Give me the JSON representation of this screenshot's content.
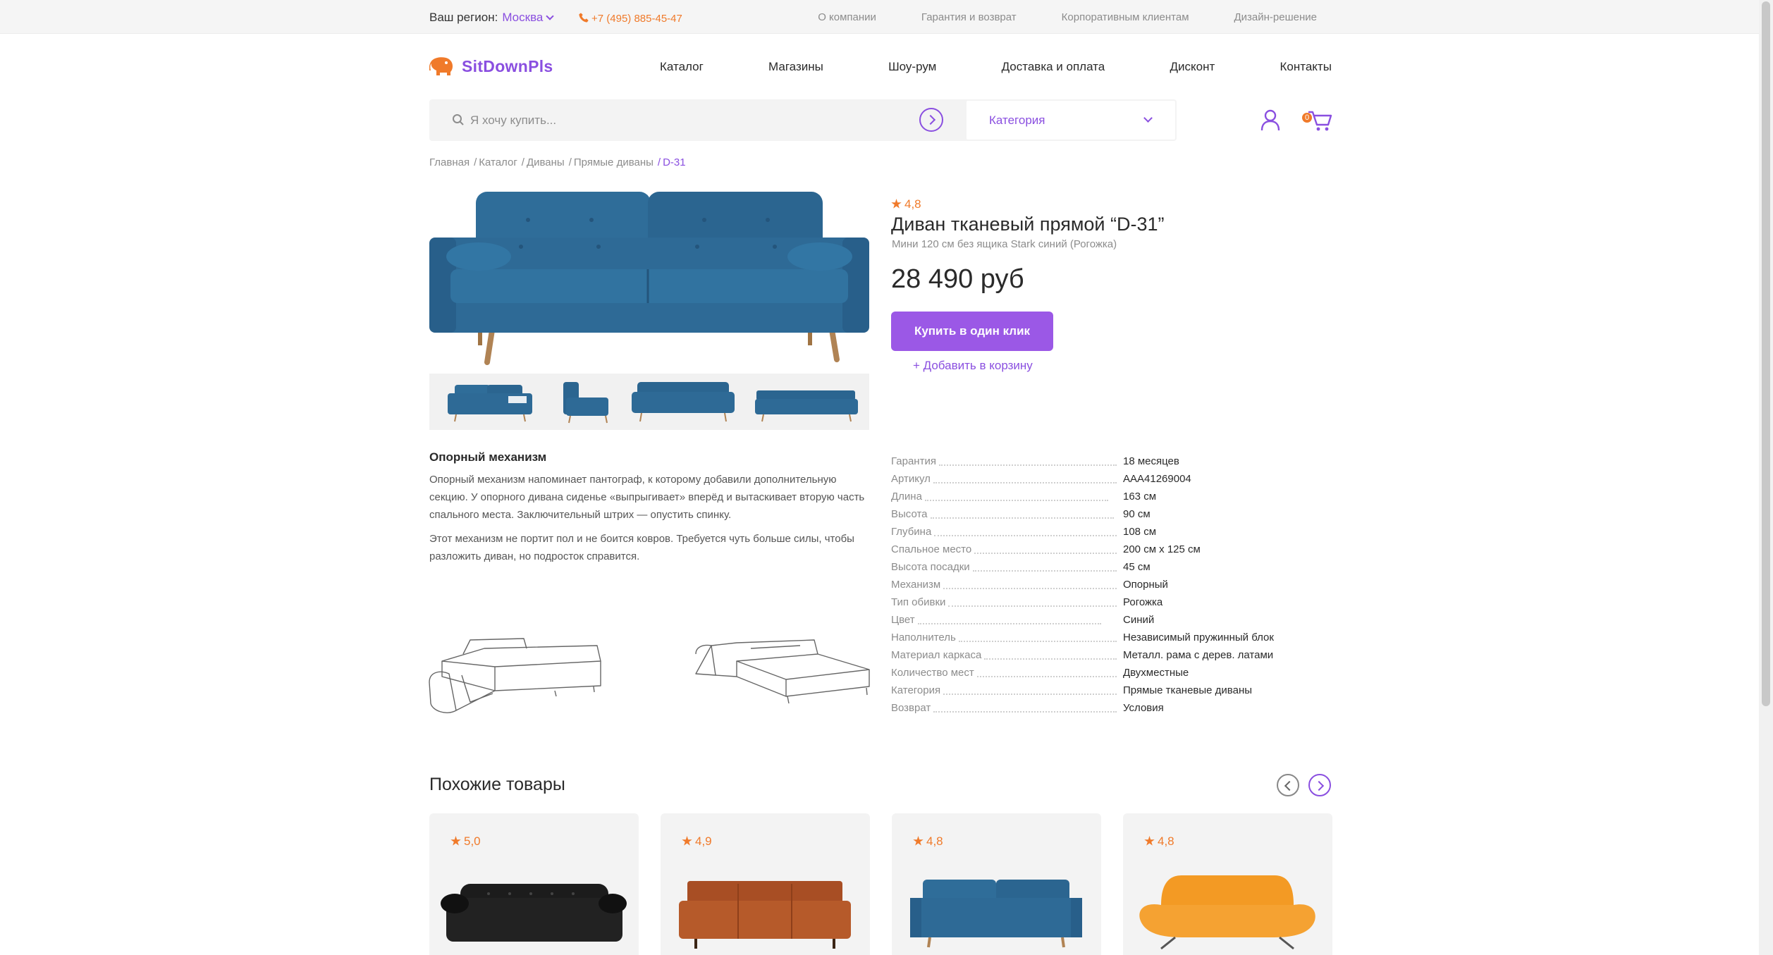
{
  "topbar": {
    "region_label": "Ваш регион:",
    "city": "Москва",
    "phone": "+7 (495) 885-45-47",
    "links": [
      "О компании",
      "Гарантия и возврат",
      "Корпоративным клиентам",
      "Дизайн-решение"
    ]
  },
  "header": {
    "logo_text": "SitDownPls",
    "nav": [
      "Каталог",
      "Магазины",
      "Шоу-рум",
      "Доставка и оплата",
      "Дисконт",
      "Контакты"
    ],
    "search_placeholder": "Я хочу купить...",
    "category_label": "Категория",
    "cart_count": "0"
  },
  "breadcrumb": [
    "Главная",
    "Каталог",
    "Диваны",
    "Прямые диваны",
    "D-31"
  ],
  "product": {
    "rating": "4,8",
    "title": "Диван тканевый прямой “D-31”",
    "subtitle": "Мини 120 см без ящика Stark синий (Рогожка)",
    "price": "28 490 руб",
    "buy_label": "Купить в один клик",
    "add_to_cart_label": "+ Добавить в корзину",
    "color": "#2f6d99"
  },
  "description": {
    "title": "Опорный механизм",
    "paragraphs": [
      "Опорный механизм напоминает пантограф, к которому добавили дополнительную секцию. У опорного дивана сиденье «выпрыгивает» вперёд и вытаскивает вторую часть спального места. Заключительный штрих — опустить спинку.",
      "Этот механизм не портит пол и не боится ковров. Требуется чуть больше силы, чтобы разложить диван, но подросток справится."
    ]
  },
  "specs": [
    {
      "label": "Гарантия",
      "value": "18 месяцев"
    },
    {
      "label": "Артикул",
      "value": "AAA41269004"
    },
    {
      "label": "Длина",
      "value": "163 см"
    },
    {
      "label": "Высота",
      "value": "90 см"
    },
    {
      "label": "Глубина",
      "value": "108 см"
    },
    {
      "label": "Спальное место",
      "value": "200 см х 125 см"
    },
    {
      "label": "Высота посадки",
      "value": "45 см"
    },
    {
      "label": "Механизм",
      "value": "Опорный"
    },
    {
      "label": "Тип обивки",
      "value": "Рогожка"
    },
    {
      "label": "Цвет",
      "value": "Синий"
    },
    {
      "label": "Наполнитель",
      "value": "Независимый пружинный блок"
    },
    {
      "label": "Материал каркаса",
      "value": "Металл. рама с дерев. латами"
    },
    {
      "label": "Количество мест",
      "value": "Двухместные"
    },
    {
      "label": "Категория",
      "value": "Прямые тканевые диваны"
    },
    {
      "label": "Возврат",
      "value": "Условия"
    }
  ],
  "similar": {
    "title": "Похожие товары",
    "items": [
      {
        "rating": "5,0",
        "color": "#1c1c1c"
      },
      {
        "rating": "4,9",
        "color": "#a84e24"
      },
      {
        "rating": "4,8",
        "color": "#2f6d99"
      },
      {
        "rating": "4,8",
        "color": "#f39a24"
      }
    ]
  },
  "colors": {
    "accent": "#8a4fe0",
    "button": "#9b58e6",
    "orange": "#f07a2a"
  }
}
